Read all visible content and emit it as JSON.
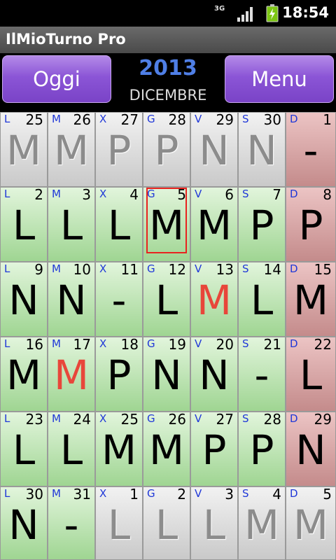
{
  "status_bar": {
    "time": "18:54",
    "network": "3G",
    "signal_icon": "signal-icon",
    "battery_icon": "battery-charging-icon"
  },
  "app": {
    "title": "IlMioTurno Pro"
  },
  "header": {
    "today_button": "Oggi",
    "menu_button": "Menu",
    "year": "2013",
    "month": "DICEMBRE"
  },
  "colors": {
    "gray": "#d6d6d6",
    "green": "#b6e0ac",
    "red": "#d8a8a8",
    "highlight": "#e8463a",
    "day_letter": "#2038d8",
    "year": "#4f7fe6",
    "button": "#8b55d6"
  },
  "calendar": {
    "weeks": [
      [
        {
          "dow": "L",
          "day": "25",
          "shift": "M",
          "tone": "gray"
        },
        {
          "dow": "M",
          "day": "26",
          "shift": "M",
          "tone": "gray"
        },
        {
          "dow": "X",
          "day": "27",
          "shift": "P",
          "tone": "gray"
        },
        {
          "dow": "G",
          "day": "28",
          "shift": "P",
          "tone": "gray"
        },
        {
          "dow": "V",
          "day": "29",
          "shift": "N",
          "tone": "gray"
        },
        {
          "dow": "S",
          "day": "30",
          "shift": "N",
          "tone": "gray"
        },
        {
          "dow": "D",
          "day": "1",
          "shift": "-",
          "tone": "red"
        }
      ],
      [
        {
          "dow": "L",
          "day": "2",
          "shift": "L",
          "tone": "green"
        },
        {
          "dow": "M",
          "day": "3",
          "shift": "L",
          "tone": "green"
        },
        {
          "dow": "X",
          "day": "4",
          "shift": "L",
          "tone": "green"
        },
        {
          "dow": "G",
          "day": "5",
          "shift": "M",
          "tone": "green",
          "today": true
        },
        {
          "dow": "V",
          "day": "6",
          "shift": "M",
          "tone": "green"
        },
        {
          "dow": "S",
          "day": "7",
          "shift": "P",
          "tone": "green"
        },
        {
          "dow": "D",
          "day": "8",
          "shift": "P",
          "tone": "red"
        }
      ],
      [
        {
          "dow": "L",
          "day": "9",
          "shift": "N",
          "tone": "green"
        },
        {
          "dow": "M",
          "day": "10",
          "shift": "N",
          "tone": "green"
        },
        {
          "dow": "X",
          "day": "11",
          "shift": "-",
          "tone": "green"
        },
        {
          "dow": "G",
          "day": "12",
          "shift": "L",
          "tone": "green"
        },
        {
          "dow": "V",
          "day": "13",
          "shift": "M",
          "tone": "green",
          "highlight": true
        },
        {
          "dow": "S",
          "day": "14",
          "shift": "L",
          "tone": "green"
        },
        {
          "dow": "D",
          "day": "15",
          "shift": "M",
          "tone": "red"
        }
      ],
      [
        {
          "dow": "L",
          "day": "16",
          "shift": "M",
          "tone": "green"
        },
        {
          "dow": "M",
          "day": "17",
          "shift": "M",
          "tone": "green",
          "highlight": true
        },
        {
          "dow": "X",
          "day": "18",
          "shift": "P",
          "tone": "green"
        },
        {
          "dow": "G",
          "day": "19",
          "shift": "N",
          "tone": "green"
        },
        {
          "dow": "V",
          "day": "20",
          "shift": "N",
          "tone": "green"
        },
        {
          "dow": "S",
          "day": "21",
          "shift": "-",
          "tone": "green"
        },
        {
          "dow": "D",
          "day": "22",
          "shift": "L",
          "tone": "red"
        }
      ],
      [
        {
          "dow": "L",
          "day": "23",
          "shift": "L",
          "tone": "green"
        },
        {
          "dow": "M",
          "day": "24",
          "shift": "L",
          "tone": "green"
        },
        {
          "dow": "X",
          "day": "25",
          "shift": "M",
          "tone": "green"
        },
        {
          "dow": "G",
          "day": "26",
          "shift": "M",
          "tone": "green"
        },
        {
          "dow": "V",
          "day": "27",
          "shift": "P",
          "tone": "green"
        },
        {
          "dow": "S",
          "day": "28",
          "shift": "P",
          "tone": "green"
        },
        {
          "dow": "D",
          "day": "29",
          "shift": "N",
          "tone": "red"
        }
      ],
      [
        {
          "dow": "L",
          "day": "30",
          "shift": "N",
          "tone": "green"
        },
        {
          "dow": "M",
          "day": "31",
          "shift": "-",
          "tone": "green"
        },
        {
          "dow": "X",
          "day": "1",
          "shift": "L",
          "tone": "gray"
        },
        {
          "dow": "G",
          "day": "2",
          "shift": "L",
          "tone": "gray"
        },
        {
          "dow": "V",
          "day": "3",
          "shift": "L",
          "tone": "gray"
        },
        {
          "dow": "S",
          "day": "4",
          "shift": "M",
          "tone": "gray"
        },
        {
          "dow": "D",
          "day": "5",
          "shift": "M",
          "tone": "gray"
        }
      ]
    ]
  }
}
